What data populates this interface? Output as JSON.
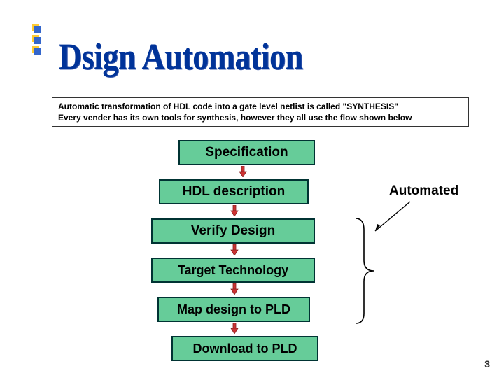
{
  "title": "Dsign Automation",
  "info_line1": "Automatic transformation of HDL code into a gate level netlist is called \"SYNTHESIS\"",
  "info_line2": "Every vender has its own tools for synthesis,  however they all use the flow shown below",
  "flow": {
    "step1": "Specification",
    "step2": "HDL description",
    "step3": "Verify Design",
    "step4": "Target Technology",
    "step5": "Map design to PLD",
    "step6": "Download to PLD"
  },
  "automated_label": "Automated",
  "slide_number": "3"
}
